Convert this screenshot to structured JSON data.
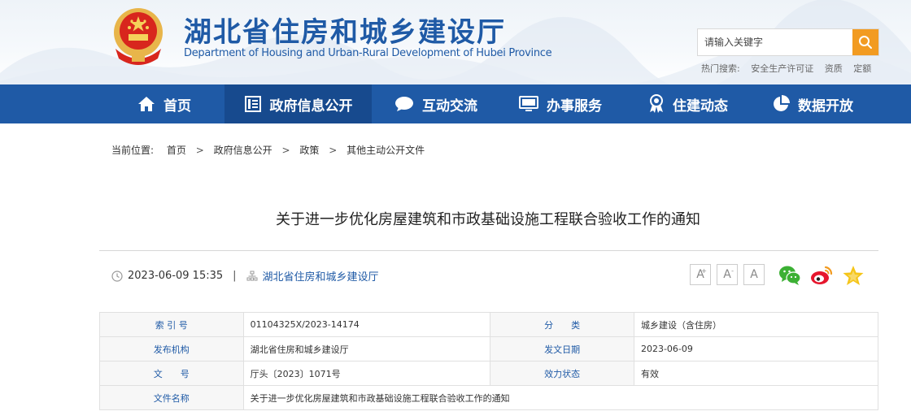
{
  "site": {
    "title": "湖北省住房和城乡建设厅",
    "subtitle": "Department of Housing and Urban-Rural Development of Hubei Province"
  },
  "search": {
    "placeholder": "请输入关键字",
    "hot_label": "热门搜索:",
    "hot_words": [
      "安全生产许可证",
      "资质",
      "定额"
    ]
  },
  "nav": {
    "items": [
      {
        "label": "首页",
        "icon": "home-icon"
      },
      {
        "label": "政府信息公开",
        "icon": "document-list-icon",
        "active": true
      },
      {
        "label": "互动交流",
        "icon": "chat-bubble-icon"
      },
      {
        "label": "办事服务",
        "icon": "monitor-icon"
      },
      {
        "label": "住建动态",
        "icon": "award-medal-icon"
      },
      {
        "label": "数据开放",
        "icon": "pie-chart-icon"
      }
    ]
  },
  "breadcrumb": {
    "prefix": "当前位置:",
    "items": [
      "首页",
      "政府信息公开",
      "政策",
      "其他主动公开文件"
    ],
    "separator": ">"
  },
  "article": {
    "title": "关于进一步优化房屋建筑和市政基础设施工程联合验收工作的通知",
    "datetime": "2023-06-09 15:35",
    "separator": "|",
    "source": "湖北省住房和城乡建设厅",
    "font_buttons": [
      "A",
      "A",
      "A"
    ],
    "share": [
      "wechat-icon",
      "weibo-icon",
      "favorite-star-icon"
    ]
  },
  "info": {
    "rows": [
      {
        "label1": "索 引 号",
        "value1": "01104325X/2023-14174",
        "label2": "分　　类",
        "value2": "城乡建设（含住房）"
      },
      {
        "label1": "发布机构",
        "value1": "湖北省住房和城乡建设厅",
        "label2": "发文日期",
        "value2": "2023-06-09"
      },
      {
        "label1": "文　　号",
        "value1": "厅头〔2023〕1071号",
        "label2": "效力状态",
        "value2": "有效"
      }
    ],
    "file_name_label": "文件名称",
    "file_name": "关于进一步优化房屋建筑和市政基础设施工程联合验收工作的通知"
  },
  "colors": {
    "brand_blue": "#1f5aa6",
    "nav_active": "#174a8e",
    "search_orange": "#f29b21"
  }
}
